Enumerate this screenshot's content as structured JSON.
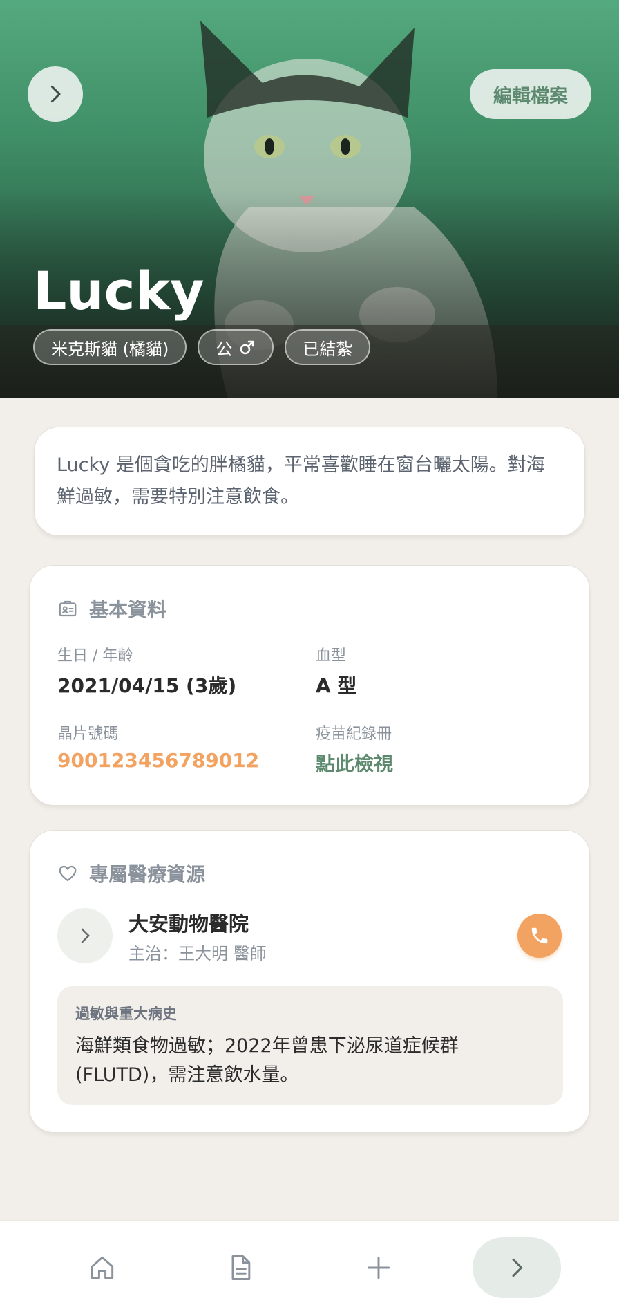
{
  "hero": {
    "pet_name": "Lucky",
    "edit_label": "編輯檔案",
    "tags": [
      {
        "label": "米克斯貓 (橘貓)"
      },
      {
        "label": "公"
      },
      {
        "label": "已結紮"
      }
    ]
  },
  "description": "Lucky 是個貪吃的胖橘貓，平常喜歡睡在窗台曬太陽。對海鮮過敏，需要特別注意飲食。",
  "basic_info": {
    "title": "基本資料",
    "fields": [
      {
        "label": "生日 / 年齡",
        "value": "2021/04/15 (3歲)"
      },
      {
        "label": "血型",
        "value": "A 型"
      },
      {
        "label": "晶片號碼",
        "value": "900123456789012"
      },
      {
        "label": "疫苗紀錄冊",
        "value": "點此檢視"
      }
    ]
  },
  "medical": {
    "title": "專屬醫療資源",
    "vet_name": "大安動物醫院",
    "vet_doctor": "主治：王大明 醫師",
    "history_label": "過敏與重大病史",
    "history_text": "海鮮類食物過敏；2022年曾患下泌尿道症候群 (FLUTD)，需注意飲水量。"
  },
  "colors": {
    "accent_orange": "#f2a261",
    "accent_green": "#5d8a6f",
    "muted_text": "#8a929c"
  }
}
